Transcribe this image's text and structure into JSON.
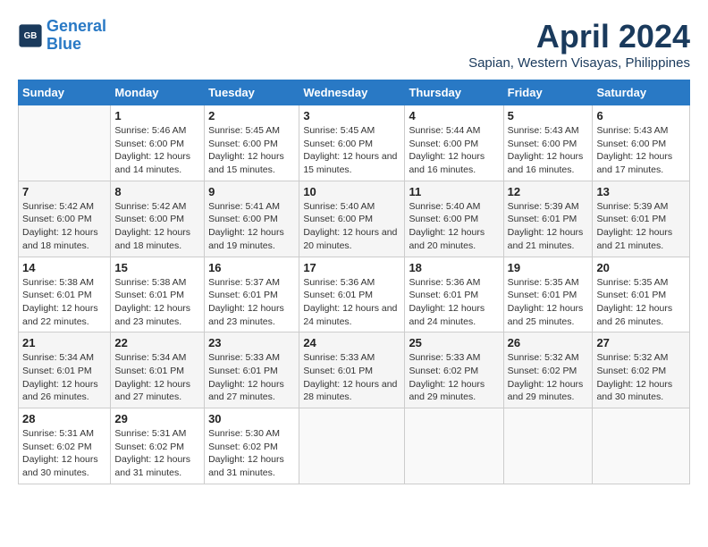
{
  "header": {
    "logo_line1": "General",
    "logo_line2": "Blue",
    "month": "April 2024",
    "location": "Sapian, Western Visayas, Philippines"
  },
  "days_of_week": [
    "Sunday",
    "Monday",
    "Tuesday",
    "Wednesday",
    "Thursday",
    "Friday",
    "Saturday"
  ],
  "weeks": [
    [
      {
        "day": "",
        "sunrise": "",
        "sunset": "",
        "daylight": ""
      },
      {
        "day": "1",
        "sunrise": "Sunrise: 5:46 AM",
        "sunset": "Sunset: 6:00 PM",
        "daylight": "Daylight: 12 hours and 14 minutes."
      },
      {
        "day": "2",
        "sunrise": "Sunrise: 5:45 AM",
        "sunset": "Sunset: 6:00 PM",
        "daylight": "Daylight: 12 hours and 15 minutes."
      },
      {
        "day": "3",
        "sunrise": "Sunrise: 5:45 AM",
        "sunset": "Sunset: 6:00 PM",
        "daylight": "Daylight: 12 hours and 15 minutes."
      },
      {
        "day": "4",
        "sunrise": "Sunrise: 5:44 AM",
        "sunset": "Sunset: 6:00 PM",
        "daylight": "Daylight: 12 hours and 16 minutes."
      },
      {
        "day": "5",
        "sunrise": "Sunrise: 5:43 AM",
        "sunset": "Sunset: 6:00 PM",
        "daylight": "Daylight: 12 hours and 16 minutes."
      },
      {
        "day": "6",
        "sunrise": "Sunrise: 5:43 AM",
        "sunset": "Sunset: 6:00 PM",
        "daylight": "Daylight: 12 hours and 17 minutes."
      }
    ],
    [
      {
        "day": "7",
        "sunrise": "Sunrise: 5:42 AM",
        "sunset": "Sunset: 6:00 PM",
        "daylight": "Daylight: 12 hours and 18 minutes."
      },
      {
        "day": "8",
        "sunrise": "Sunrise: 5:42 AM",
        "sunset": "Sunset: 6:00 PM",
        "daylight": "Daylight: 12 hours and 18 minutes."
      },
      {
        "day": "9",
        "sunrise": "Sunrise: 5:41 AM",
        "sunset": "Sunset: 6:00 PM",
        "daylight": "Daylight: 12 hours and 19 minutes."
      },
      {
        "day": "10",
        "sunrise": "Sunrise: 5:40 AM",
        "sunset": "Sunset: 6:00 PM",
        "daylight": "Daylight: 12 hours and 20 minutes."
      },
      {
        "day": "11",
        "sunrise": "Sunrise: 5:40 AM",
        "sunset": "Sunset: 6:00 PM",
        "daylight": "Daylight: 12 hours and 20 minutes."
      },
      {
        "day": "12",
        "sunrise": "Sunrise: 5:39 AM",
        "sunset": "Sunset: 6:01 PM",
        "daylight": "Daylight: 12 hours and 21 minutes."
      },
      {
        "day": "13",
        "sunrise": "Sunrise: 5:39 AM",
        "sunset": "Sunset: 6:01 PM",
        "daylight": "Daylight: 12 hours and 21 minutes."
      }
    ],
    [
      {
        "day": "14",
        "sunrise": "Sunrise: 5:38 AM",
        "sunset": "Sunset: 6:01 PM",
        "daylight": "Daylight: 12 hours and 22 minutes."
      },
      {
        "day": "15",
        "sunrise": "Sunrise: 5:38 AM",
        "sunset": "Sunset: 6:01 PM",
        "daylight": "Daylight: 12 hours and 23 minutes."
      },
      {
        "day": "16",
        "sunrise": "Sunrise: 5:37 AM",
        "sunset": "Sunset: 6:01 PM",
        "daylight": "Daylight: 12 hours and 23 minutes."
      },
      {
        "day": "17",
        "sunrise": "Sunrise: 5:36 AM",
        "sunset": "Sunset: 6:01 PM",
        "daylight": "Daylight: 12 hours and 24 minutes."
      },
      {
        "day": "18",
        "sunrise": "Sunrise: 5:36 AM",
        "sunset": "Sunset: 6:01 PM",
        "daylight": "Daylight: 12 hours and 24 minutes."
      },
      {
        "day": "19",
        "sunrise": "Sunrise: 5:35 AM",
        "sunset": "Sunset: 6:01 PM",
        "daylight": "Daylight: 12 hours and 25 minutes."
      },
      {
        "day": "20",
        "sunrise": "Sunrise: 5:35 AM",
        "sunset": "Sunset: 6:01 PM",
        "daylight": "Daylight: 12 hours and 26 minutes."
      }
    ],
    [
      {
        "day": "21",
        "sunrise": "Sunrise: 5:34 AM",
        "sunset": "Sunset: 6:01 PM",
        "daylight": "Daylight: 12 hours and 26 minutes."
      },
      {
        "day": "22",
        "sunrise": "Sunrise: 5:34 AM",
        "sunset": "Sunset: 6:01 PM",
        "daylight": "Daylight: 12 hours and 27 minutes."
      },
      {
        "day": "23",
        "sunrise": "Sunrise: 5:33 AM",
        "sunset": "Sunset: 6:01 PM",
        "daylight": "Daylight: 12 hours and 27 minutes."
      },
      {
        "day": "24",
        "sunrise": "Sunrise: 5:33 AM",
        "sunset": "Sunset: 6:01 PM",
        "daylight": "Daylight: 12 hours and 28 minutes."
      },
      {
        "day": "25",
        "sunrise": "Sunrise: 5:33 AM",
        "sunset": "Sunset: 6:02 PM",
        "daylight": "Daylight: 12 hours and 29 minutes."
      },
      {
        "day": "26",
        "sunrise": "Sunrise: 5:32 AM",
        "sunset": "Sunset: 6:02 PM",
        "daylight": "Daylight: 12 hours and 29 minutes."
      },
      {
        "day": "27",
        "sunrise": "Sunrise: 5:32 AM",
        "sunset": "Sunset: 6:02 PM",
        "daylight": "Daylight: 12 hours and 30 minutes."
      }
    ],
    [
      {
        "day": "28",
        "sunrise": "Sunrise: 5:31 AM",
        "sunset": "Sunset: 6:02 PM",
        "daylight": "Daylight: 12 hours and 30 minutes."
      },
      {
        "day": "29",
        "sunrise": "Sunrise: 5:31 AM",
        "sunset": "Sunset: 6:02 PM",
        "daylight": "Daylight: 12 hours and 31 minutes."
      },
      {
        "day": "30",
        "sunrise": "Sunrise: 5:30 AM",
        "sunset": "Sunset: 6:02 PM",
        "daylight": "Daylight: 12 hours and 31 minutes."
      },
      {
        "day": "",
        "sunrise": "",
        "sunset": "",
        "daylight": ""
      },
      {
        "day": "",
        "sunrise": "",
        "sunset": "",
        "daylight": ""
      },
      {
        "day": "",
        "sunrise": "",
        "sunset": "",
        "daylight": ""
      },
      {
        "day": "",
        "sunrise": "",
        "sunset": "",
        "daylight": ""
      }
    ]
  ]
}
